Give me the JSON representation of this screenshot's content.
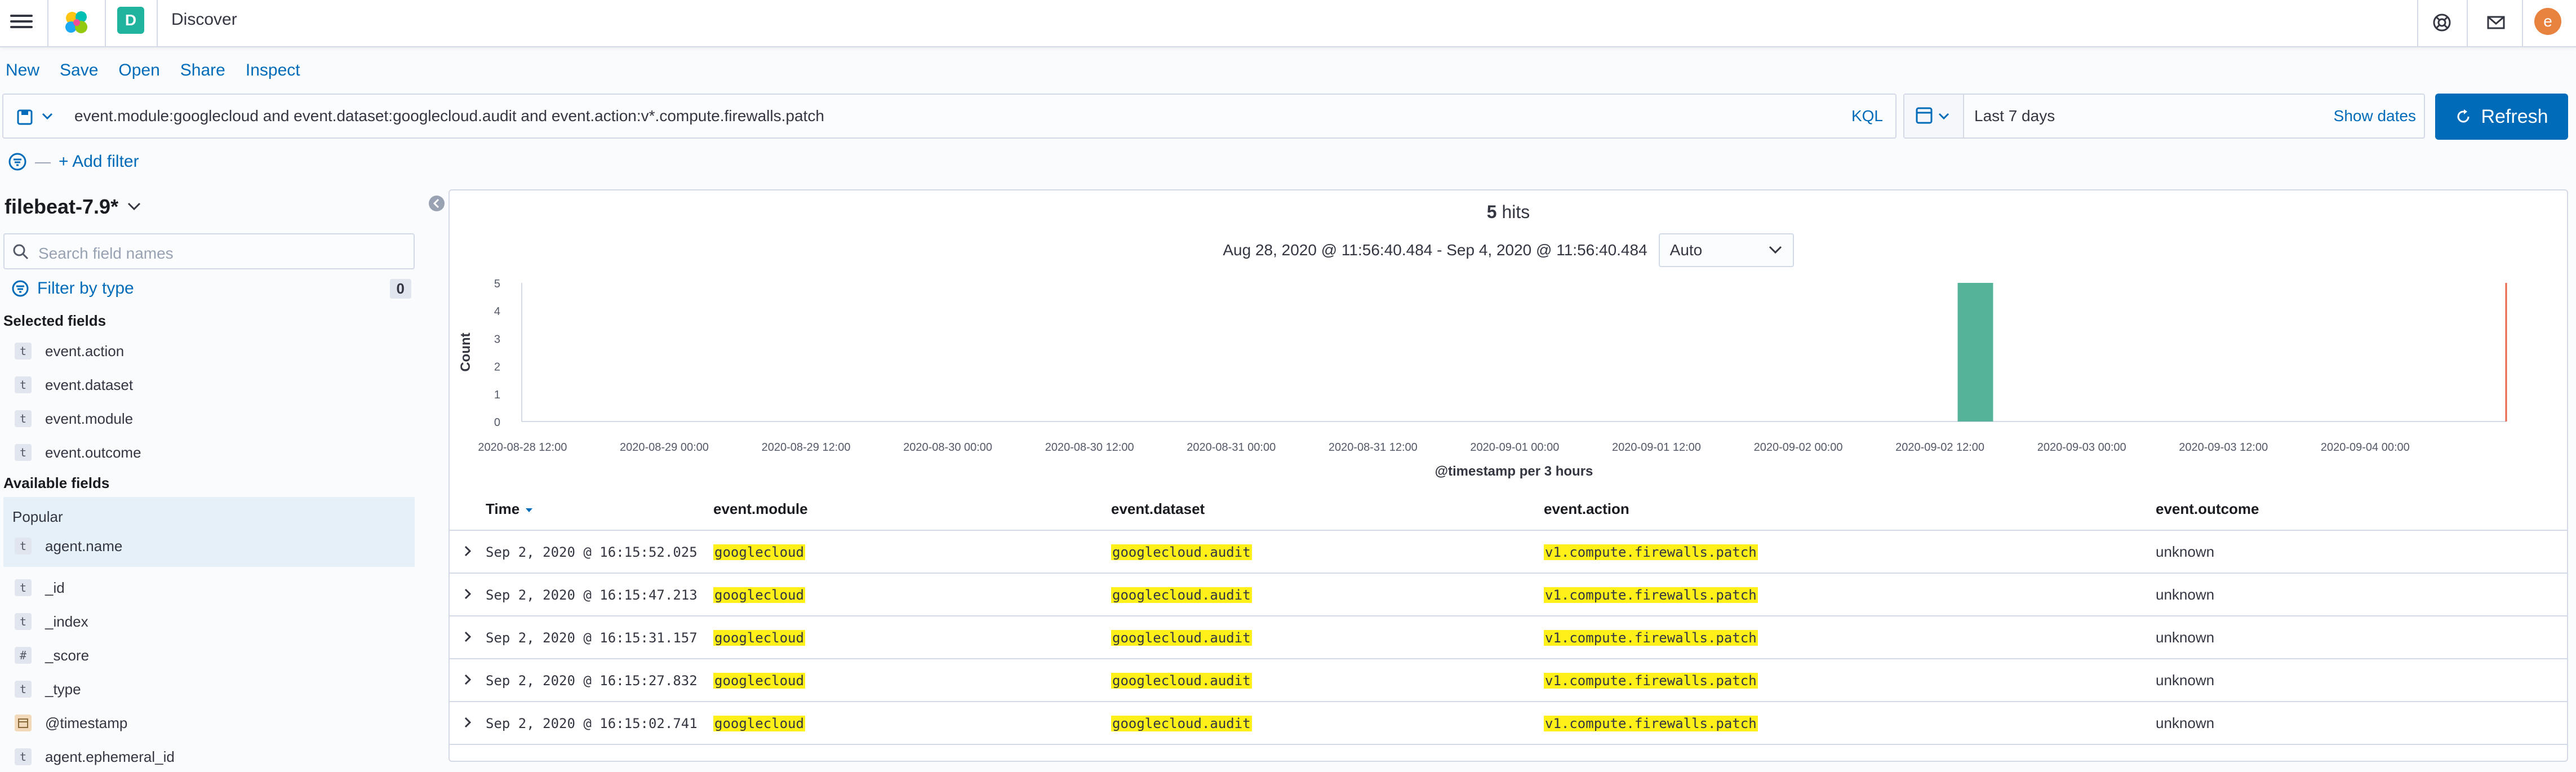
{
  "header": {
    "space_initial": "D",
    "app_title": "Discover",
    "avatar_initial": "e",
    "icons": [
      "menu-icon",
      "kibana-logo-icon",
      "help-icon",
      "newsfeed-icon"
    ]
  },
  "topnav": {
    "items": [
      "New",
      "Save",
      "Open",
      "Share",
      "Inspect"
    ]
  },
  "query": {
    "text": "event.module:googlecloud and event.dataset:googlecloud.audit and event.action:v*.compute.firewalls.patch",
    "language": "KQL"
  },
  "datepicker": {
    "value": "Last 7 days",
    "show_dates": "Show dates"
  },
  "refresh_label": "Refresh",
  "filter": {
    "add_label": "+ Add filter"
  },
  "sidebar": {
    "index_pattern": "filebeat-7.9*",
    "search_placeholder": "Search field names",
    "filter_by_type": "Filter by type",
    "filter_count": "0",
    "selected_title": "Selected fields",
    "selected_fields": [
      {
        "type": "t",
        "name": "event.action"
      },
      {
        "type": "t",
        "name": "event.dataset"
      },
      {
        "type": "t",
        "name": "event.module"
      },
      {
        "type": "t",
        "name": "event.outcome"
      }
    ],
    "available_title": "Available fields",
    "popular_label": "Popular",
    "popular_fields": [
      {
        "type": "t",
        "name": "agent.name"
      }
    ],
    "available_fields": [
      {
        "type": "t",
        "name": "_id"
      },
      {
        "type": "t",
        "name": "_index"
      },
      {
        "type": "#",
        "name": "_score"
      },
      {
        "type": "t",
        "name": "_type"
      },
      {
        "type": "date",
        "name": "@timestamp"
      },
      {
        "type": "t",
        "name": "agent.ephemeral_id"
      }
    ]
  },
  "histogram": {
    "hits_count": "5",
    "hits_label": "hits",
    "range": "Aug 28, 2020 @ 11:56:40.484 - Sep 4, 2020 @ 11:56:40.484",
    "interval": "Auto"
  },
  "chart_data": {
    "type": "bar",
    "ylabel": "Count",
    "xlabel": "@timestamp per 3 hours",
    "ylim": [
      0,
      5
    ],
    "y_ticks": [
      "0",
      "1",
      "2",
      "3",
      "4",
      "5"
    ],
    "x_ticks": [
      "2020-08-28 12:00",
      "2020-08-29 00:00",
      "2020-08-29 12:00",
      "2020-08-30 00:00",
      "2020-08-30 12:00",
      "2020-08-31 00:00",
      "2020-08-31 12:00",
      "2020-09-01 00:00",
      "2020-09-01 12:00",
      "2020-09-02 00:00",
      "2020-09-02 12:00",
      "2020-09-03 00:00",
      "2020-09-03 12:00",
      "2020-09-04 00:00"
    ],
    "bars": [
      {
        "x": "2020-09-02 15:00",
        "value": 5
      }
    ],
    "current_time_marker": "2020-09-04 11:56",
    "x_start": "2020-08-28 11:56",
    "bar_color": "#54b399",
    "marker_color": "#e7664c"
  },
  "table": {
    "columns": [
      "Time",
      "event.module",
      "event.dataset",
      "event.action",
      "event.outcome"
    ],
    "rows": [
      [
        "Sep 2, 2020 @ 16:15:52.025",
        "googlecloud",
        "googlecloud.audit",
        "v1.compute.firewalls.patch",
        "unknown"
      ],
      [
        "Sep 2, 2020 @ 16:15:47.213",
        "googlecloud",
        "googlecloud.audit",
        "v1.compute.firewalls.patch",
        "unknown"
      ],
      [
        "Sep 2, 2020 @ 16:15:31.157",
        "googlecloud",
        "googlecloud.audit",
        "v1.compute.firewalls.patch",
        "unknown"
      ],
      [
        "Sep 2, 2020 @ 16:15:27.832",
        "googlecloud",
        "googlecloud.audit",
        "v1.compute.firewalls.patch",
        "unknown"
      ],
      [
        "Sep 2, 2020 @ 16:15:02.741",
        "googlecloud",
        "googlecloud.audit",
        "v1.compute.firewalls.patch",
        "unknown"
      ]
    ]
  }
}
